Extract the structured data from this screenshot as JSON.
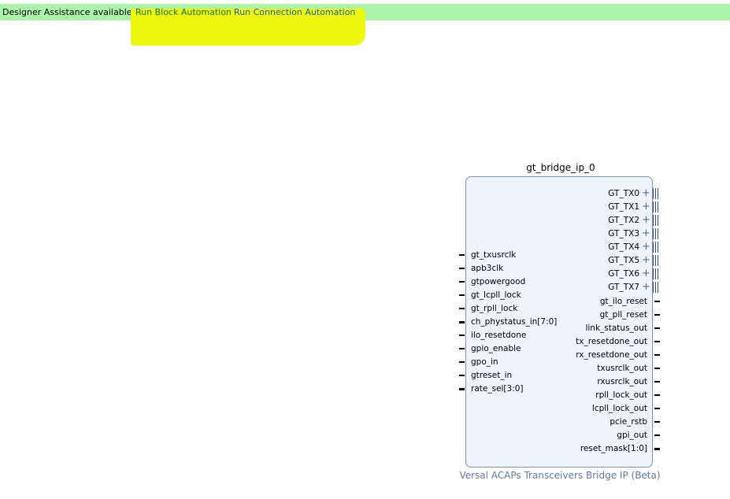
{
  "banner": {
    "message": "Designer Assistance available.",
    "run_block_automation": "Run Block Automation",
    "run_connection_automation": "Run Connection Automation"
  },
  "colors": {
    "banner_bg": "#aaf5aa",
    "highlight": "#eef80e",
    "block_fill": "#eef5fd",
    "block_border": "#7a94b7",
    "subtitle": "#5c7ca3"
  },
  "block": {
    "name": "gt_bridge_ip_0",
    "subtitle": "Versal ACAPs Transceivers Bridge IP (Beta)",
    "left_ports": [
      {
        "label": "gt_txusrclk",
        "bus": false
      },
      {
        "label": "apb3clk",
        "bus": false
      },
      {
        "label": "gtpowergood",
        "bus": false
      },
      {
        "label": "gt_lcpll_lock",
        "bus": false
      },
      {
        "label": "gt_rpll_lock",
        "bus": false
      },
      {
        "label": "ch_phystatus_in[7:0]",
        "bus": true
      },
      {
        "label": "ilo_resetdone",
        "bus": false
      },
      {
        "label": "gpio_enable",
        "bus": false
      },
      {
        "label": "gpo_in",
        "bus": false
      },
      {
        "label": "gtreset_in",
        "bus": false
      },
      {
        "label": "rate_sel[3:0]",
        "bus": true
      }
    ],
    "interface_ports": [
      {
        "label": "GT_TX0",
        "icon": "expand-plus-icon"
      },
      {
        "label": "GT_TX1",
        "icon": "expand-plus-icon"
      },
      {
        "label": "GT_TX2",
        "icon": "expand-plus-icon"
      },
      {
        "label": "GT_TX3",
        "icon": "expand-plus-icon"
      },
      {
        "label": "GT_TX4",
        "icon": "expand-plus-icon"
      },
      {
        "label": "GT_TX5",
        "icon": "expand-plus-icon"
      },
      {
        "label": "GT_TX6",
        "icon": "expand-plus-icon"
      },
      {
        "label": "GT_TX7",
        "icon": "expand-plus-icon"
      }
    ],
    "right_ports": [
      {
        "label": "gt_ilo_reset",
        "bus": false
      },
      {
        "label": "gt_pll_reset",
        "bus": false
      },
      {
        "label": "link_status_out",
        "bus": false
      },
      {
        "label": "tx_resetdone_out",
        "bus": false
      },
      {
        "label": "rx_resetdone_out",
        "bus": false
      },
      {
        "label": "txusrclk_out",
        "bus": false
      },
      {
        "label": "rxusrclk_out",
        "bus": false
      },
      {
        "label": "rpll_lock_out",
        "bus": false
      },
      {
        "label": "lcpll_lock_out",
        "bus": false
      },
      {
        "label": "pcie_rstb",
        "bus": false
      },
      {
        "label": "gpi_out",
        "bus": false
      },
      {
        "label": "reset_mask[1:0]",
        "bus": true
      }
    ]
  }
}
